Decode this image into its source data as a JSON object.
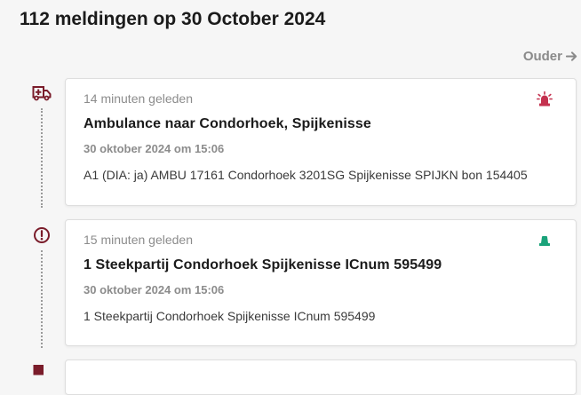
{
  "page_title": "112 meldingen op 30 October 2024",
  "nav": {
    "older_label": "Ouder"
  },
  "colors": {
    "ambulance": "#b0294a",
    "police": "#1aa37a",
    "alert": "#7a1c2a"
  },
  "items": [
    {
      "type_icon": "ambulance-icon",
      "badge_icon": "siren-icon",
      "time_ago": "14 minuten geleden",
      "title": "Ambulance naar Condorhoek, Spijkenisse",
      "date": "30 oktober 2024 om 15:06",
      "message": "A1 (DIA: ja) AMBU 17161 Condorhoek 3201SG Spijkenisse SPIJKN bon 154405"
    },
    {
      "type_icon": "alert-circle-icon",
      "badge_icon": "police-light-icon",
      "time_ago": "15 minuten geleden",
      "title": "1 Steekpartij Condorhoek Spijkenisse ICnum 595499",
      "date": "30 oktober 2024 om 15:06",
      "message": "1 Steekpartij Condorhoek Spijkenisse ICnum 595499"
    }
  ]
}
